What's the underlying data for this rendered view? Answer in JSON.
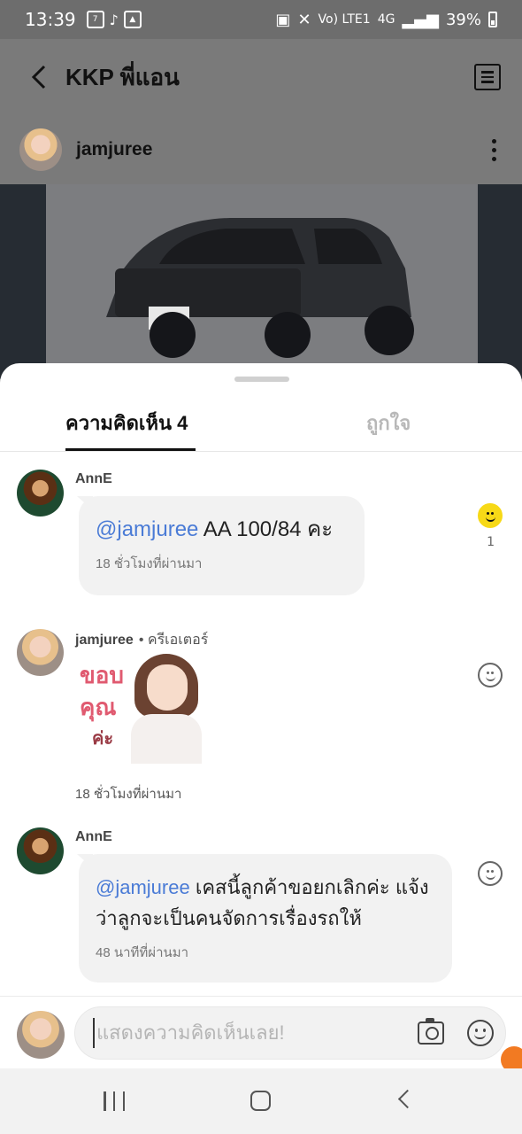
{
  "status_bar": {
    "time": "13:39",
    "network": "4G",
    "lte_label": "Vo) LTE1",
    "battery": "39%"
  },
  "header": {
    "title": "KKP พี่แอน"
  },
  "post": {
    "author": "jamjuree"
  },
  "sheet": {
    "tab_comments": "ความคิดเห็น 4",
    "tab_likes": "ถูกใจ"
  },
  "comments": [
    {
      "name": "AnnE",
      "mention": "@jamjuree",
      "text": " AA 100/84 คะ",
      "time": "18 ชั่วโมงที่ผ่านมา",
      "reaction_count": "1"
    },
    {
      "name": "jamjuree",
      "role": "• ครีเอเตอร์",
      "sticker_line1": "ขอบ",
      "sticker_line2": "คุณ",
      "sticker_line3": "ค่ะ",
      "time": "18 ชั่วโมงที่ผ่านมา"
    },
    {
      "name": "AnnE",
      "mention": "@jamjuree",
      "text": " เคสนี้ลูกค้าขอยกเลิกค่ะ แจ้งว่าลูกจะเป็นคนจัดการเรื่องรถให้",
      "time": "48 นาทีที่ผ่านมา"
    }
  ],
  "input": {
    "placeholder": "แสดงความคิดเห็นเลย!"
  },
  "colors": {
    "mention": "#4a7bd6",
    "reaction_active": "#f7d917",
    "floating_badge": "#f27a22"
  }
}
